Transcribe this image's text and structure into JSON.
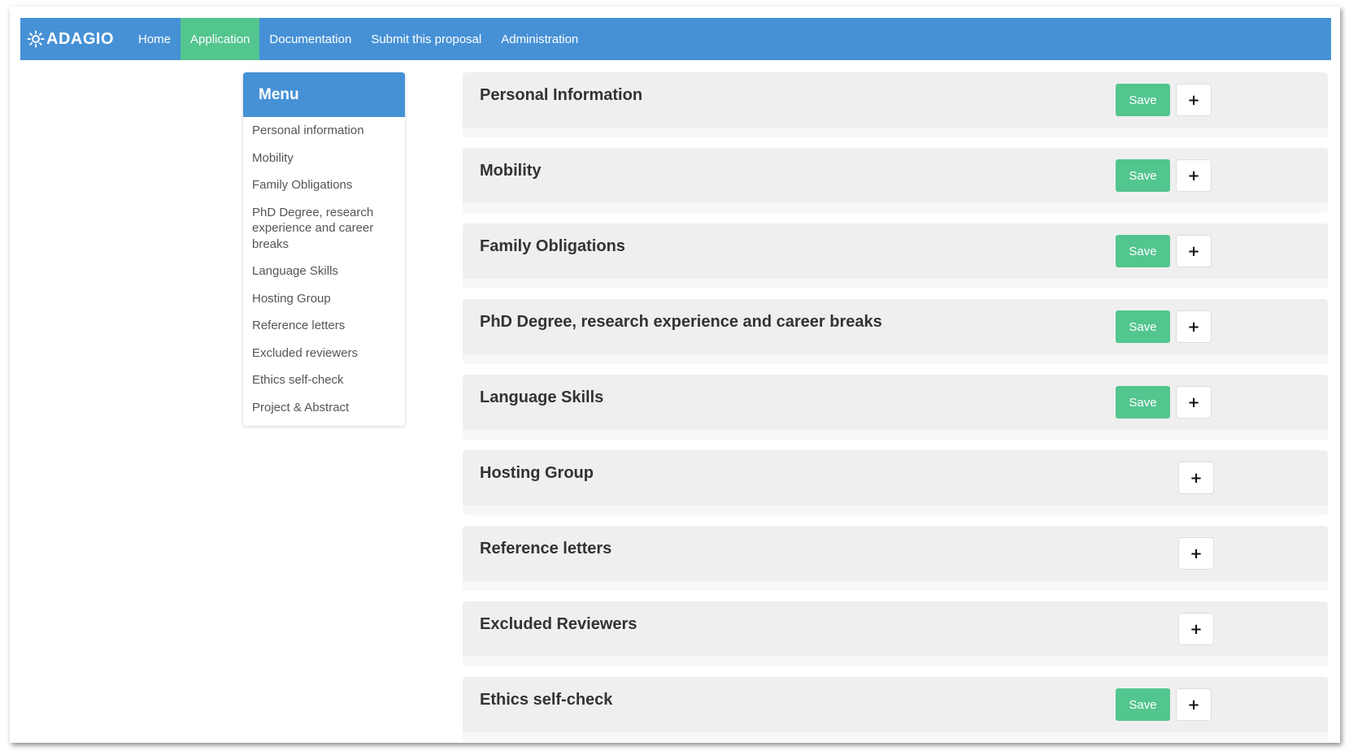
{
  "navbar": {
    "brand": "ADAGIO",
    "brand_icon": "gear-logo-icon",
    "colors": {
      "bar": "#4691d6",
      "active": "#53c58f"
    },
    "items": [
      {
        "label": "Home",
        "active": false
      },
      {
        "label": "Application",
        "active": true
      },
      {
        "label": "Documentation",
        "active": false
      },
      {
        "label": "Submit this proposal",
        "active": false
      },
      {
        "label": "Administration",
        "active": false
      }
    ]
  },
  "menu": {
    "title": "Menu",
    "items": [
      "Personal information",
      "Mobility",
      "Family Obligations",
      "PhD Degree, research experience and career breaks",
      "Language Skills",
      "Hosting Group",
      "Reference letters",
      "Excluded reviewers",
      "Ethics self-check",
      "Project & Abstract"
    ]
  },
  "sections": [
    {
      "title": "Personal Information",
      "save": "Save",
      "expand": "+"
    },
    {
      "title": "Mobility",
      "save": "Save",
      "expand": "+"
    },
    {
      "title": "Family Obligations",
      "save": "Save",
      "expand": "+"
    },
    {
      "title": "PhD Degree, research experience and career breaks",
      "save": "Save",
      "expand": "+"
    },
    {
      "title": "Language Skills",
      "save": "Save",
      "expand": "+"
    },
    {
      "title": "Hosting Group",
      "save": null,
      "expand": "+"
    },
    {
      "title": "Reference letters",
      "save": null,
      "expand": "+"
    },
    {
      "title": "Excluded Reviewers",
      "save": null,
      "expand": "+"
    },
    {
      "title": "Ethics self-check",
      "save": "Save",
      "expand": "+"
    }
  ]
}
